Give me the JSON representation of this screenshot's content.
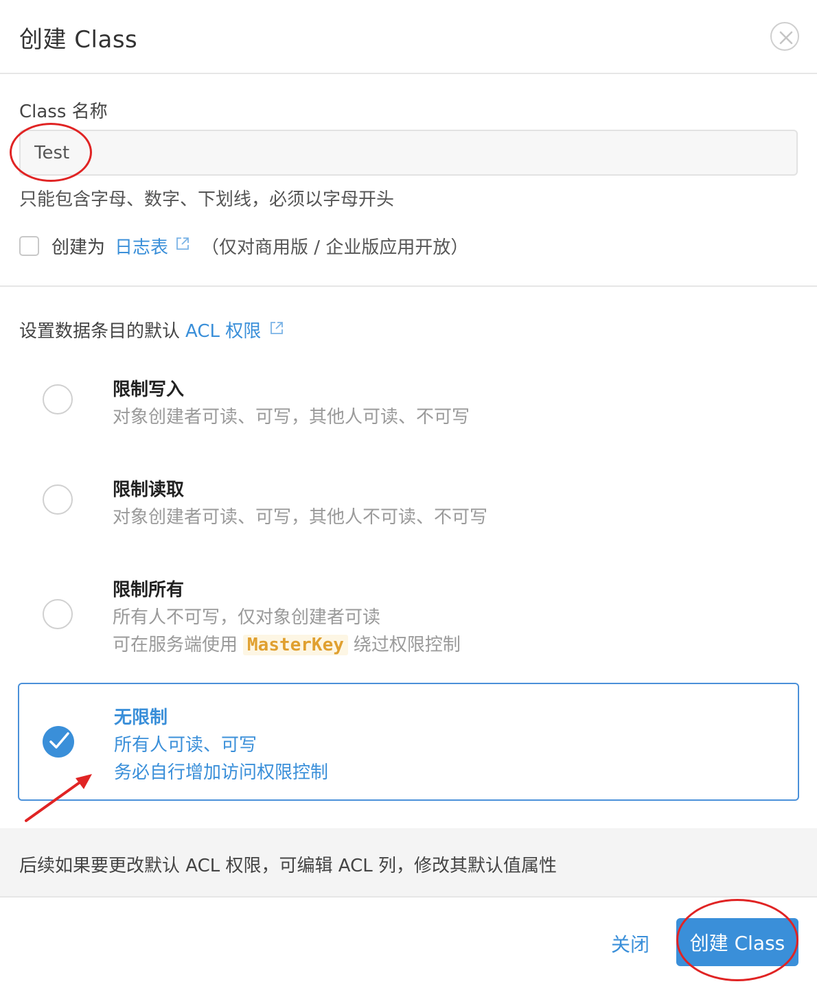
{
  "dialog": {
    "title": "创建 Class"
  },
  "form": {
    "name_label": "Class 名称",
    "name_value": "Test",
    "name_help": "只能包含字母、数字、下划线，必须以字母开头",
    "log_prefix": "创建为",
    "log_link": "日志表",
    "log_note": "（仅对商用版 / 企业版应用开放）"
  },
  "acl": {
    "heading_prefix": "设置数据条目的默认",
    "heading_link": "ACL 权限",
    "options": [
      {
        "title": "限制写入",
        "desc1": "对象创建者可读、可写，其他人可读、不可写",
        "selected": false
      },
      {
        "title": "限制读取",
        "desc1": "对象创建者可读、可写，其他人不可读、不可写",
        "selected": false
      },
      {
        "title": "限制所有",
        "desc1": "所有人不可写，仅对象创建者可读",
        "desc2_prefix": "可在服务端使用",
        "desc2_code": "MasterKey",
        "desc2_suffix": "绕过权限控制",
        "selected": false
      },
      {
        "title": "无限制",
        "desc1": "所有人可读、可写",
        "desc2": "务必自行增加访问权限控制",
        "selected": true
      }
    ]
  },
  "footer": {
    "note": "后续如果要更改默认 ACL 权限，可编辑 ACL 列，修改其默认值属性",
    "close_label": "关闭",
    "create_label": "创建 Class"
  },
  "colors": {
    "accent": "#3a8fd9",
    "annotation": "#e02424",
    "code_text": "#e0a030"
  },
  "icons": [
    "close-icon",
    "external-link-icon",
    "checkmark-icon",
    "arrow-annotation"
  ]
}
